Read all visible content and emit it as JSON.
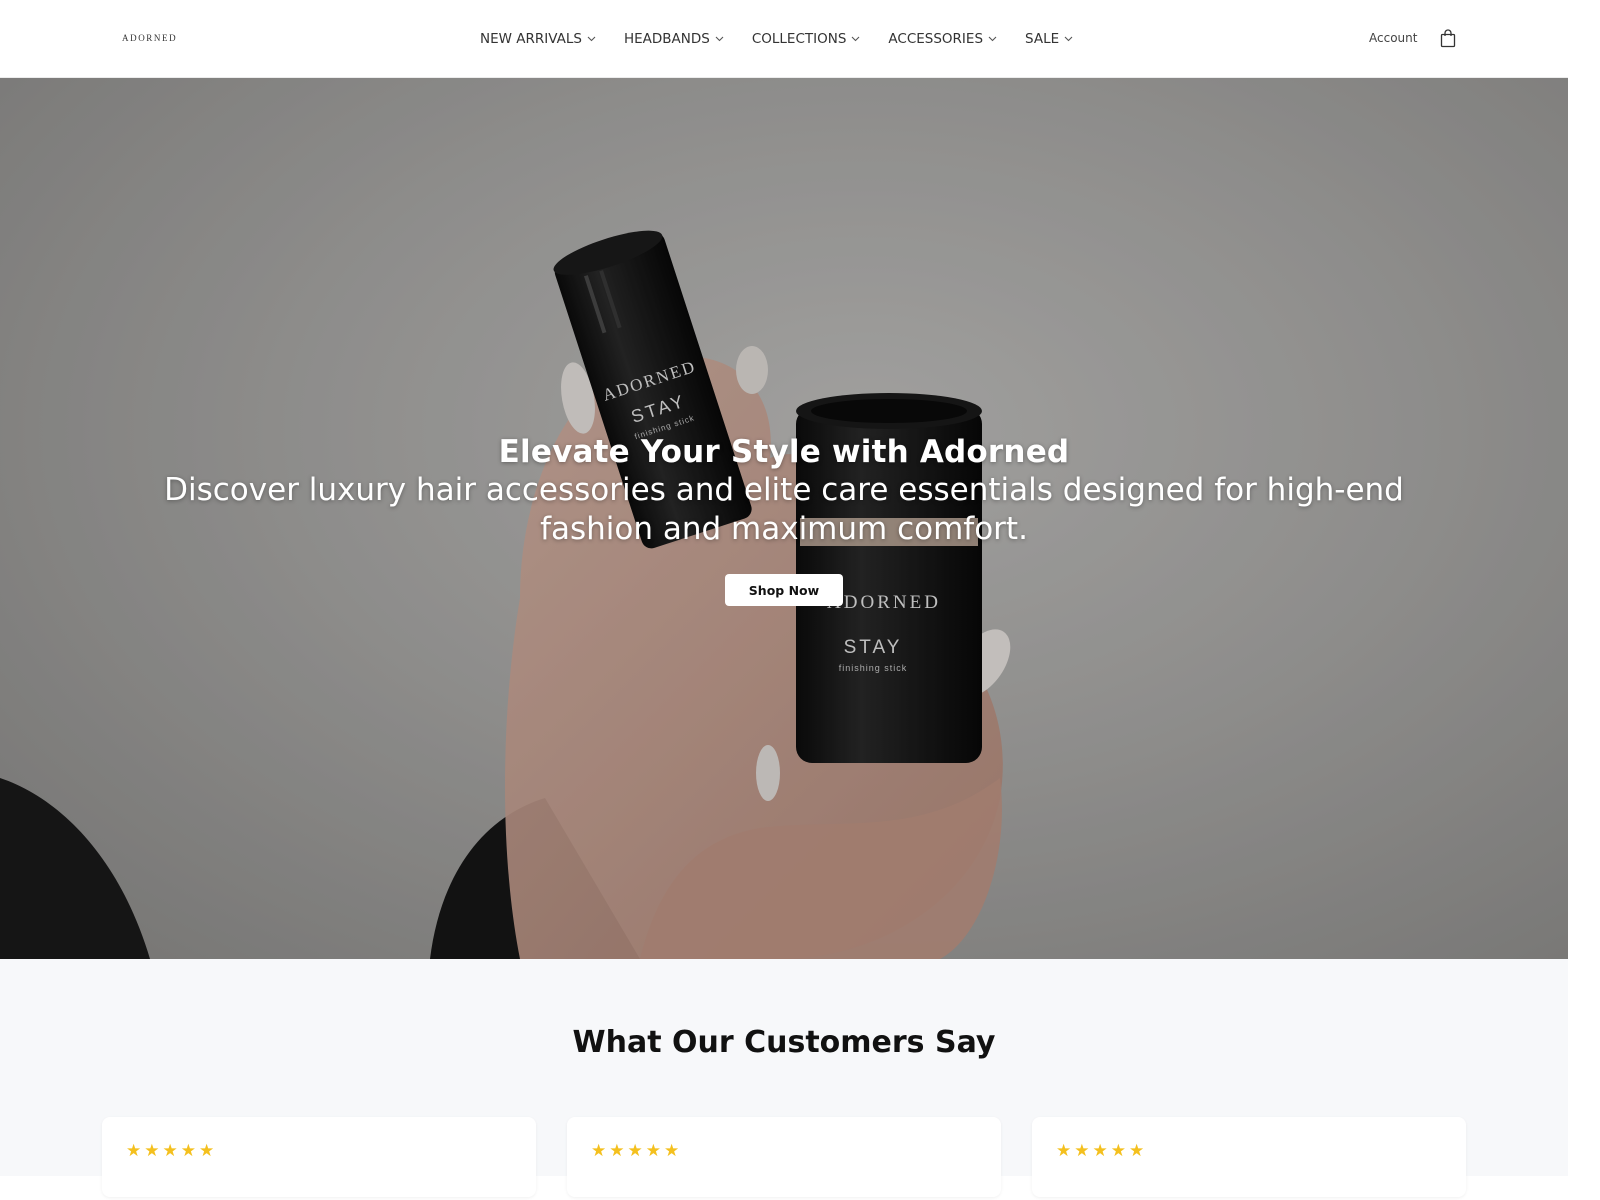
{
  "header": {
    "logo": "ADORNED",
    "nav": [
      {
        "label": "NEW ARRIVALS",
        "icon": "chevron-down-icon"
      },
      {
        "label": "HEADBANDS",
        "icon": "chevron-down-icon"
      },
      {
        "label": "COLLECTIONS",
        "icon": "chevron-down-icon"
      },
      {
        "label": "ACCESSORIES",
        "icon": "chevron-down-icon"
      },
      {
        "label": "SALE",
        "icon": "chevron-down-icon"
      }
    ],
    "account_label": "Account",
    "cart_icon": "shopping-bag-icon"
  },
  "hero": {
    "title": "Elevate Your Style with Adorned",
    "subtitle": "Discover luxury hair accessories and elite care essentials designed for high-end fashion and maximum comfort.",
    "cta_label": "Shop Now",
    "product_brand": "ADORNED",
    "product_name": "STAY",
    "product_type": "finishing stick"
  },
  "testimonials": {
    "title": "What Our Customers Say",
    "star_color": "#f4c01e",
    "cards": [
      {
        "stars": "★★★★★",
        "rating": 5
      },
      {
        "stars": "★★★★★",
        "rating": 5
      },
      {
        "stars": "★★★★★",
        "rating": 5
      }
    ]
  }
}
